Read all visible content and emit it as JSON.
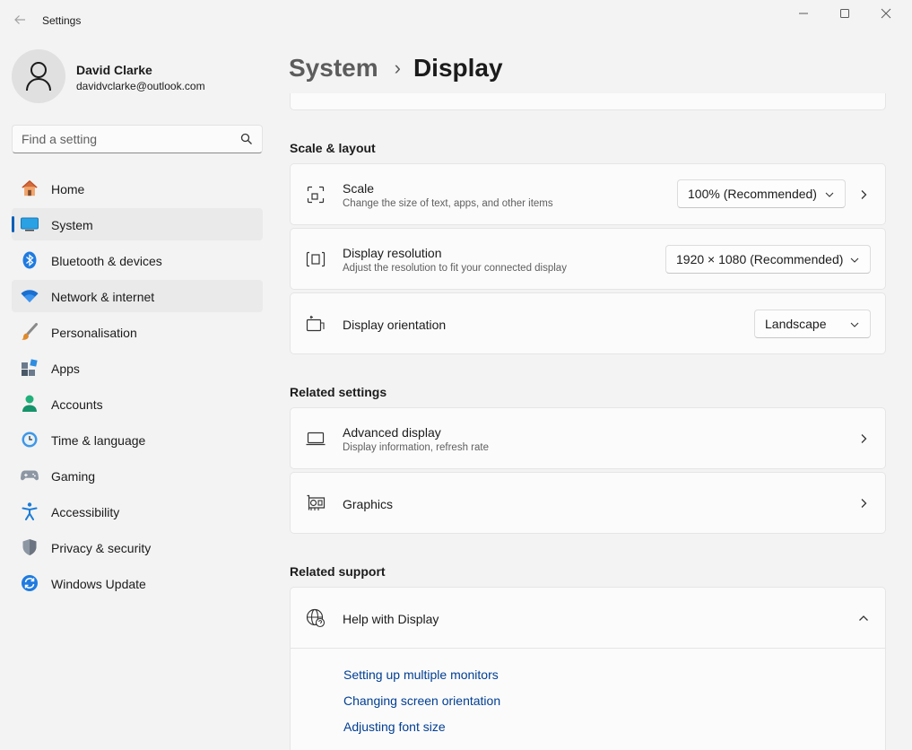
{
  "window": {
    "app_title": "Settings"
  },
  "profile": {
    "name": "David Clarke",
    "email": "davidvclarke@outlook.com"
  },
  "search": {
    "placeholder": "Find a setting"
  },
  "sidebar": {
    "items": [
      {
        "label": "Home",
        "icon": "home-icon"
      },
      {
        "label": "System",
        "icon": "system-icon",
        "selected": true
      },
      {
        "label": "Bluetooth & devices",
        "icon": "bluetooth-icon"
      },
      {
        "label": "Network & internet",
        "icon": "wifi-icon"
      },
      {
        "label": "Personalisation",
        "icon": "brush-icon"
      },
      {
        "label": "Apps",
        "icon": "apps-icon"
      },
      {
        "label": "Accounts",
        "icon": "accounts-icon"
      },
      {
        "label": "Time & language",
        "icon": "clock-globe-icon"
      },
      {
        "label": "Gaming",
        "icon": "gamepad-icon"
      },
      {
        "label": "Accessibility",
        "icon": "accessibility-icon"
      },
      {
        "label": "Privacy & security",
        "icon": "shield-icon"
      },
      {
        "label": "Windows Update",
        "icon": "update-icon"
      }
    ]
  },
  "breadcrumb": {
    "parent": "System",
    "separator": "›",
    "current": "Display"
  },
  "scale_layout": {
    "heading": "Scale & layout",
    "scale": {
      "title": "Scale",
      "description": "Change the size of text, apps, and other items",
      "value": "100% (Recommended)"
    },
    "resolution": {
      "title": "Display resolution",
      "description": "Adjust the resolution to fit your connected display",
      "value": "1920 × 1080 (Recommended)"
    },
    "orientation": {
      "title": "Display orientation",
      "value": "Landscape"
    }
  },
  "related_settings": {
    "heading": "Related settings",
    "advanced": {
      "title": "Advanced display",
      "description": "Display information, refresh rate"
    },
    "graphics": {
      "title": "Graphics"
    }
  },
  "related_support": {
    "heading": "Related support",
    "help": {
      "title": "Help with Display",
      "links": [
        "Setting up multiple monitors",
        "Changing screen orientation",
        "Adjusting font size"
      ]
    }
  },
  "colors": {
    "accent": "#005fb8",
    "link": "#003e92",
    "background": "#f3f3f3",
    "card": "#fbfbfb"
  }
}
